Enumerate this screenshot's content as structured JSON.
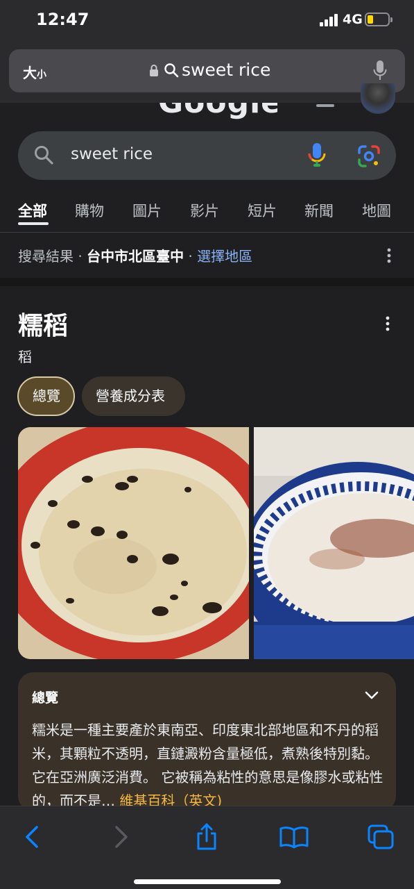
{
  "status_bar": {
    "time": "12:47",
    "network": "4G"
  },
  "browser": {
    "text_size_label": "大",
    "text_size_small": "小",
    "address_text": "sweet rice"
  },
  "google": {
    "logo_text": "Google",
    "search_query": "sweet rice",
    "tabs": [
      {
        "label": "全部",
        "active": true
      },
      {
        "label": "購物"
      },
      {
        "label": "圖片"
      },
      {
        "label": "影片"
      },
      {
        "label": "短片"
      },
      {
        "label": "新聞"
      },
      {
        "label": "地圖"
      }
    ],
    "location": {
      "prefix": "搜尋結果 · ",
      "place": "台中市北區臺中",
      "separator": " · ",
      "change_link": "選擇地區"
    }
  },
  "knowledge_panel": {
    "title": "糯稻",
    "subtitle": "稻",
    "chips": [
      "總覽",
      "營養成分表"
    ],
    "images": [
      "food-image-1",
      "food-image-2"
    ],
    "overview": {
      "heading": "總覽",
      "text": "糯米是一種主要產於東南亞、印度東北部地區和不丹的稻米，其顆粒不透明，直鏈澱粉含量極低，煮熟後特別黏。它在亞洲廣泛消費。 它被稱為粘性的意思是像膠水或粘性的，而不是",
      "ellipsis": "… ",
      "source": "維基百科（英文)"
    }
  },
  "colors": {
    "link": "#8ab4f8",
    "source": "#f5b942",
    "background": "#1f1f21"
  }
}
